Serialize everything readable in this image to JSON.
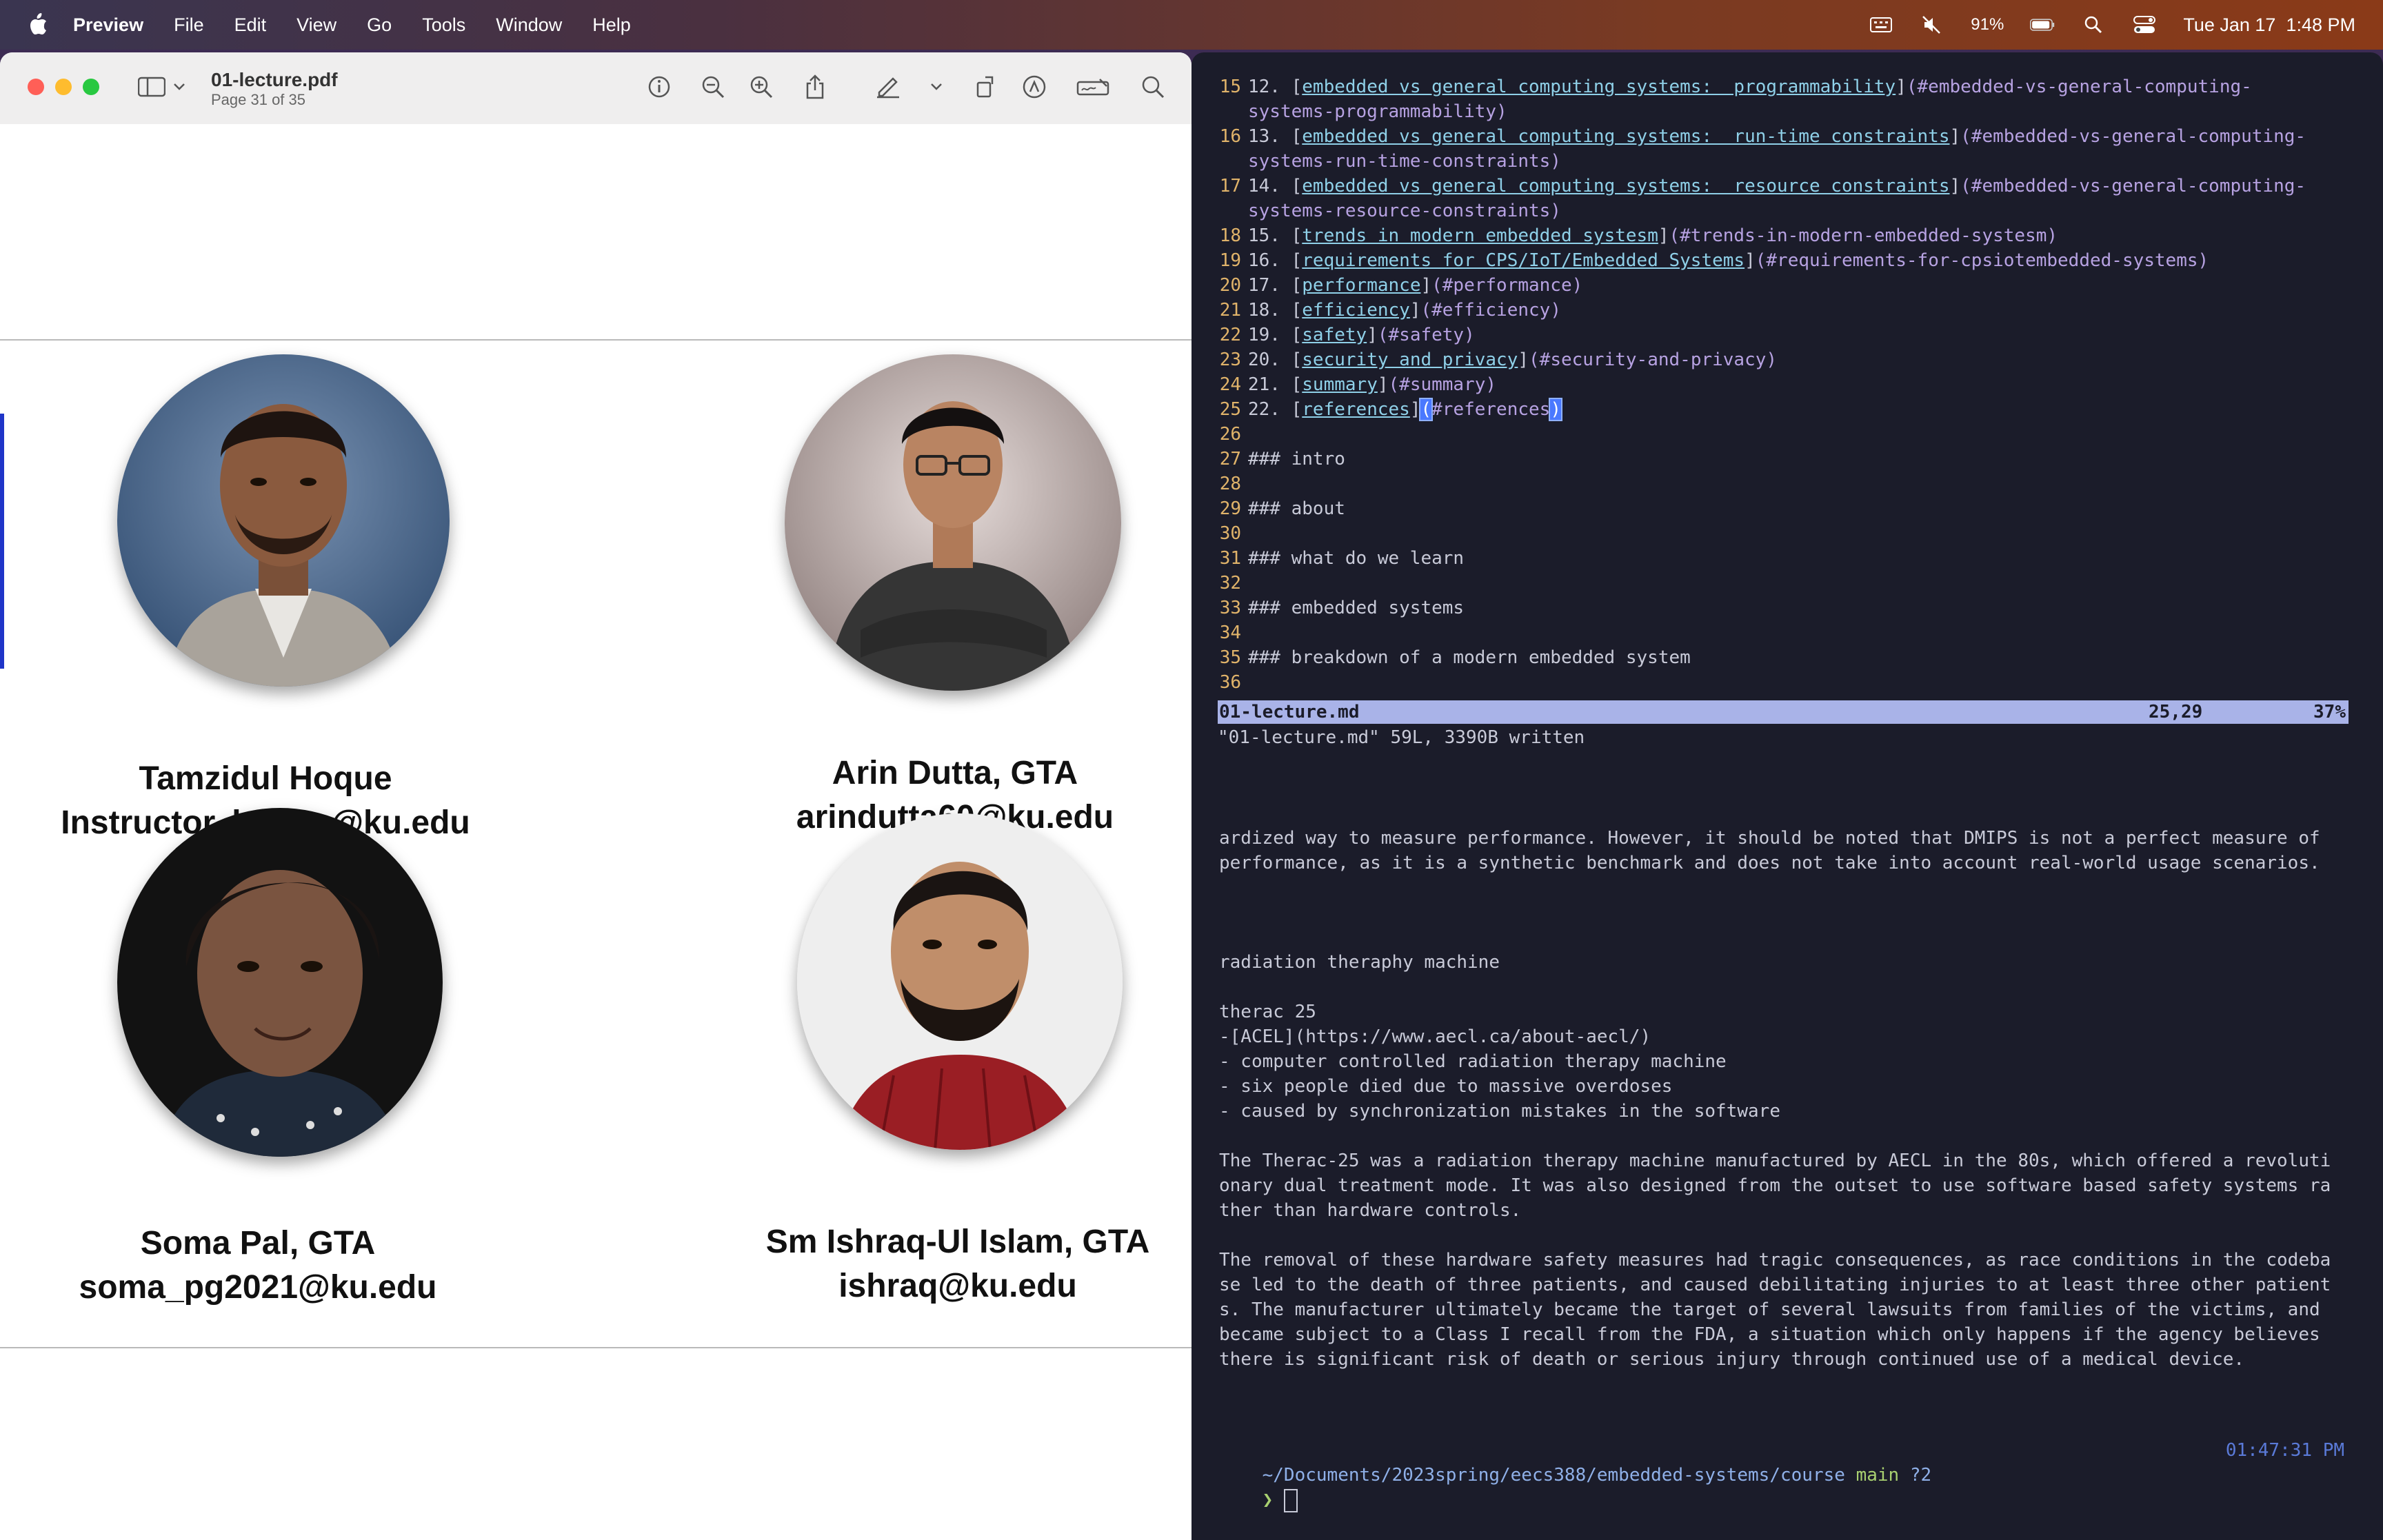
{
  "menubar": {
    "app": "Preview",
    "items": [
      "File",
      "Edit",
      "View",
      "Go",
      "Tools",
      "Window",
      "Help"
    ],
    "battery": "91%",
    "datetime": "Tue Jan 17  1:48 PM"
  },
  "preview": {
    "title": "01-lecture.pdf",
    "subtitle": "Page 31 of 35",
    "page_number": "31",
    "people": [
      {
        "name": "Tamzidul Hoque",
        "detail": "Instructor, hoque@ku.edu"
      },
      {
        "name": "Arin Dutta, GTA",
        "detail": "arindutta60@ku.edu"
      },
      {
        "name": "Soma Pal, GTA",
        "detail": "soma_pg2021@ku.edu"
      },
      {
        "name": "Sm Ishraq-Ul Islam, GTA",
        "detail": "ishraq@ku.edu"
      }
    ]
  },
  "editor": {
    "lines": [
      {
        "n": "15",
        "num": "12.",
        "link": "embedded vs general computing systems:  programmability",
        "anchor": "(#embedded-vs-general-computing-"
      },
      {
        "n": "",
        "cont": "systems-programmability)"
      },
      {
        "n": "16",
        "num": "13.",
        "link": "embedded vs general computing systems:  run-time constraints",
        "anchor": "(#embedded-vs-general-computing-"
      },
      {
        "n": "",
        "cont": "systems-run-time-constraints)"
      },
      {
        "n": "17",
        "num": "14.",
        "link": "embedded vs general computing systems:  resource constraints",
        "anchor": "(#embedded-vs-general-computing-"
      },
      {
        "n": "",
        "cont": "systems-resource-constraints)"
      },
      {
        "n": "18",
        "num": "15.",
        "link": "trends in modern embedded systesm",
        "anchor": "(#trends-in-modern-embedded-systesm)"
      },
      {
        "n": "19",
        "num": "16.",
        "link": "requirements for CPS/IoT/Embedded Systems",
        "anchor": "(#requirements-for-cpsiotembedded-systems)"
      },
      {
        "n": "20",
        "num": "17.",
        "link": "performance",
        "anchor": "(#performance)"
      },
      {
        "n": "21",
        "num": "18.",
        "link": "efficiency",
        "anchor": "(#efficiency)"
      },
      {
        "n": "22",
        "num": "19.",
        "link": "safety",
        "anchor": "(#safety)"
      },
      {
        "n": "23",
        "num": "20.",
        "link": "security and privacy",
        "anchor": "(#security-and-privacy)"
      },
      {
        "n": "24",
        "num": "21.",
        "link": "summary",
        "anchor": "(#summary)"
      },
      {
        "n": "25",
        "num": "22.",
        "link": "references",
        "anchor": "#references"
      },
      {
        "n": "26",
        "text": ""
      },
      {
        "n": "27",
        "text": "### intro"
      },
      {
        "n": "28",
        "text": ""
      },
      {
        "n": "29",
        "text": "### about"
      },
      {
        "n": "30",
        "text": ""
      },
      {
        "n": "31",
        "text": "### what do we learn"
      },
      {
        "n": "32",
        "text": ""
      },
      {
        "n": "33",
        "text": "### embedded systems"
      },
      {
        "n": "34",
        "text": ""
      },
      {
        "n": "35",
        "text": "### breakdown of a modern embedded system"
      },
      {
        "n": "36",
        "text": ""
      }
    ],
    "status_file": "01-lecture.md",
    "status_pos": "25,29",
    "status_pct": "37%",
    "message": "\"01-lecture.md\" 59L, 3390B written"
  },
  "shell": {
    "lines": [
      "ardized way to measure performance. However, it should be noted that DMIPS is not a perfect measure of",
      "performance, as it is a synthetic benchmark and does not take into account real-world usage scenarios.",
      "",
      "",
      "",
      "radiation theraphy machine",
      "",
      "therac 25",
      "-[ACEL](https://www.aecl.ca/about-aecl/)",
      "- computer controlled radiation therapy machine",
      "- six people died due to massive overdoses",
      "- caused by synchronization mistakes in the software",
      "",
      "The Therac-25 was a radiation therapy machine manufactured by AECL in the 80s, which offered a revoluti",
      "onary dual treatment mode. It was also designed from the outset to use software based safety systems ra",
      "ther than hardware controls.",
      "",
      "The removal of these hardware safety measures had tragic consequences, as race conditions in the codeba",
      "se led to the death of three patients, and caused debilitating injuries to at least three other patient",
      "s. The manufacturer ultimately became the target of several lawsuits from families of the victims, and",
      "became subject to a Class I recall from the FDA, a situation which only happens if the agency believes",
      "there is significant risk of death or serious injury through continued use of a medical device."
    ],
    "prompt_path": "~/Documents/2023spring/eecs388/embedded-systems/course",
    "prompt_branch": "main",
    "prompt_flag": "?2",
    "prompt_time": "01:47:31 PM",
    "prompt_symbol": "❯"
  }
}
